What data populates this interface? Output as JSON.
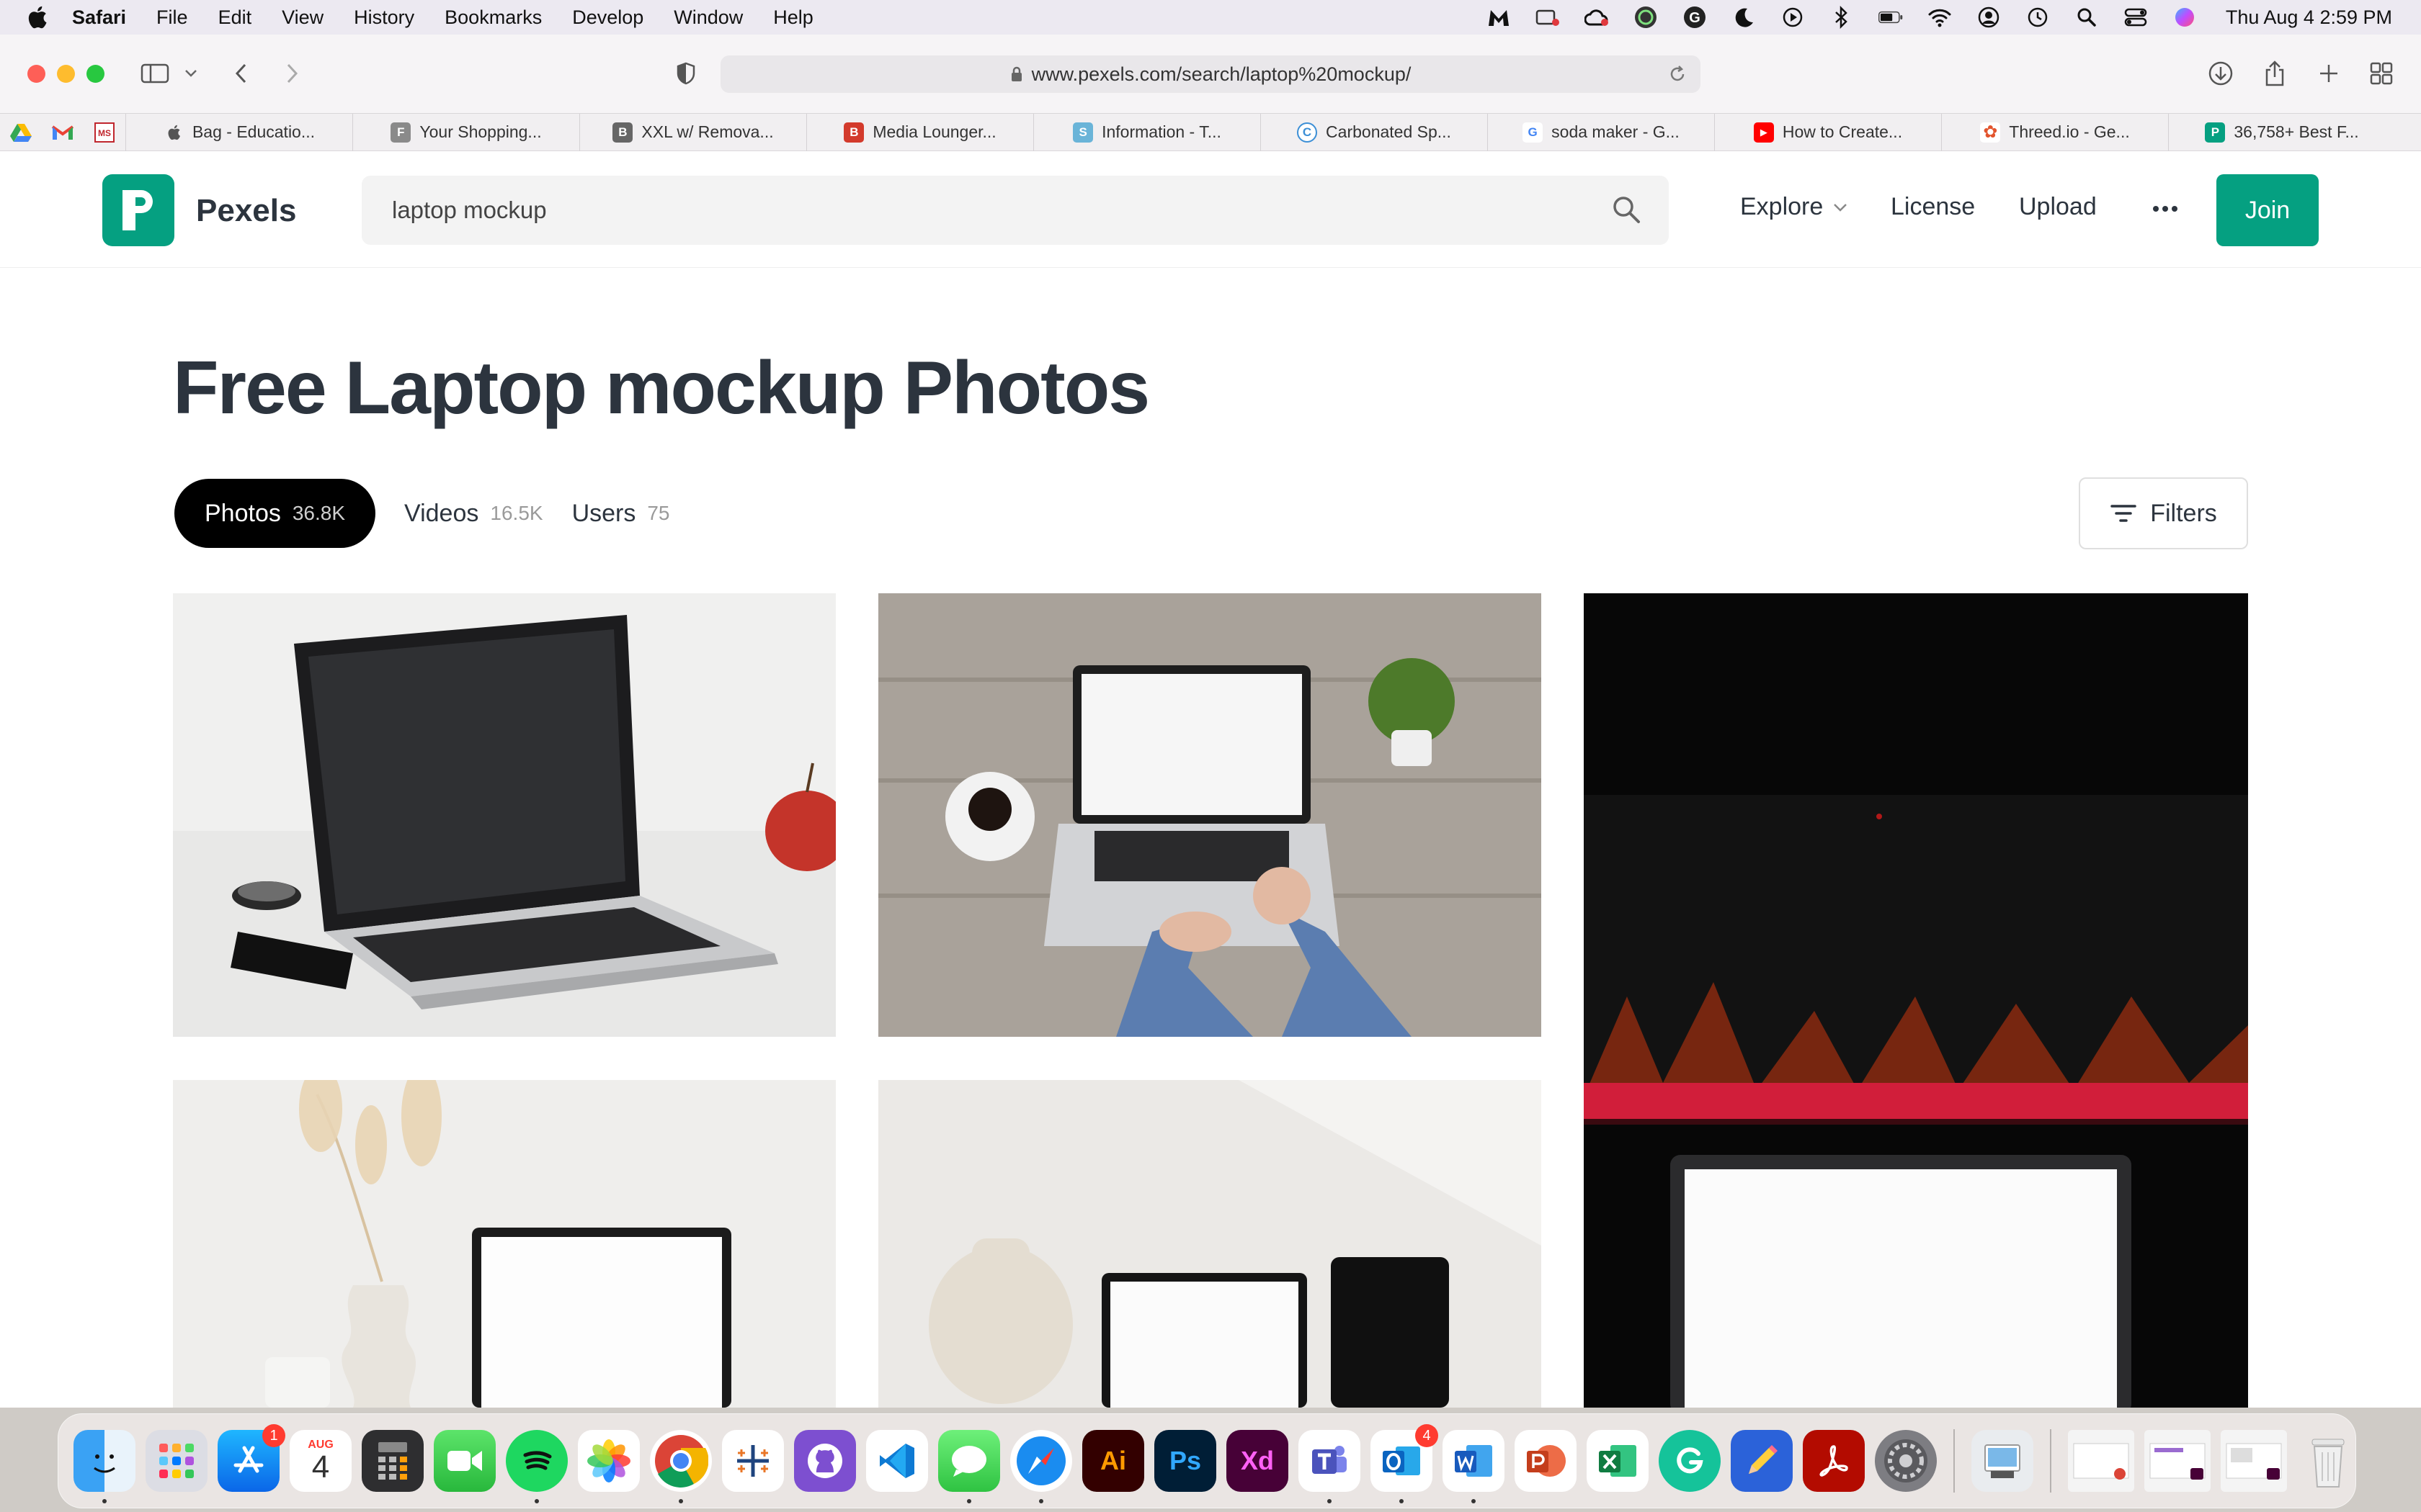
{
  "menubar": {
    "items": [
      "Safari",
      "File",
      "Edit",
      "View",
      "History",
      "Bookmarks",
      "Develop",
      "Window",
      "Help"
    ],
    "clock": "Thu Aug 4  2:59 PM"
  },
  "browser": {
    "url": "www.pexels.com/search/laptop%20mockup/",
    "favorites": [
      {
        "label": "Bag - Educatio...",
        "icon": "apple-icon",
        "color": "#444444"
      },
      {
        "label": "Your Shopping...",
        "icon": "F",
        "color": "#888888"
      },
      {
        "label": "XXL w/ Remova...",
        "icon": "B",
        "color": "#666666"
      },
      {
        "label": "Media Lounger...",
        "icon": "B",
        "color": "#d33a2c"
      },
      {
        "label": "Information - T...",
        "icon": "S",
        "color": "#6ab4d8"
      },
      {
        "label": "Carbonated Sp...",
        "icon": "C",
        "color": "#3c8fd6"
      },
      {
        "label": "soda maker - G...",
        "icon": "G",
        "color": "#4285f4"
      },
      {
        "label": "How to Create...",
        "icon": "▶",
        "color": "#ff0000"
      },
      {
        "label": "Threed.io - Ge...",
        "icon": "✿",
        "color": "#e2542d"
      },
      {
        "label": "36,758+ Best F...",
        "icon": "P",
        "color": "#05a081"
      }
    ]
  },
  "site": {
    "logo_text": "Pexels",
    "search_value": "laptop mockup",
    "nav": {
      "explore": "Explore",
      "license": "License",
      "upload": "Upload",
      "join": "Join"
    },
    "title": "Free Laptop mockup Photos",
    "tabs": [
      {
        "label": "Photos",
        "count": "36.8K"
      },
      {
        "label": "Videos",
        "count": "16.5K"
      },
      {
        "label": "Users",
        "count": "75"
      }
    ],
    "filters": "Filters",
    "brand_color": "#05a081"
  },
  "dock": {
    "calendar_month": "AUG",
    "calendar_day": "4",
    "appstore_badge": "1",
    "outlook_badge": "4",
    "apps": [
      "Finder",
      "Launchpad",
      "App Store",
      "Calendar",
      "Calculator",
      "FaceTime",
      "Spotify",
      "Photos",
      "Chrome",
      "Tableau",
      "GitHub Desktop",
      "VS Code",
      "Messages",
      "Safari",
      "Illustrator",
      "Photoshop",
      "Adobe XD",
      "Teams",
      "Outlook",
      "Word",
      "PowerPoint",
      "Excel",
      "Grammarly",
      "Pencil",
      "Acrobat",
      "System Preferences",
      "Preview",
      "Trash"
    ],
    "labels": {
      "illustrator": "Ai",
      "photoshop": "Ps",
      "xd": "Xd"
    }
  }
}
